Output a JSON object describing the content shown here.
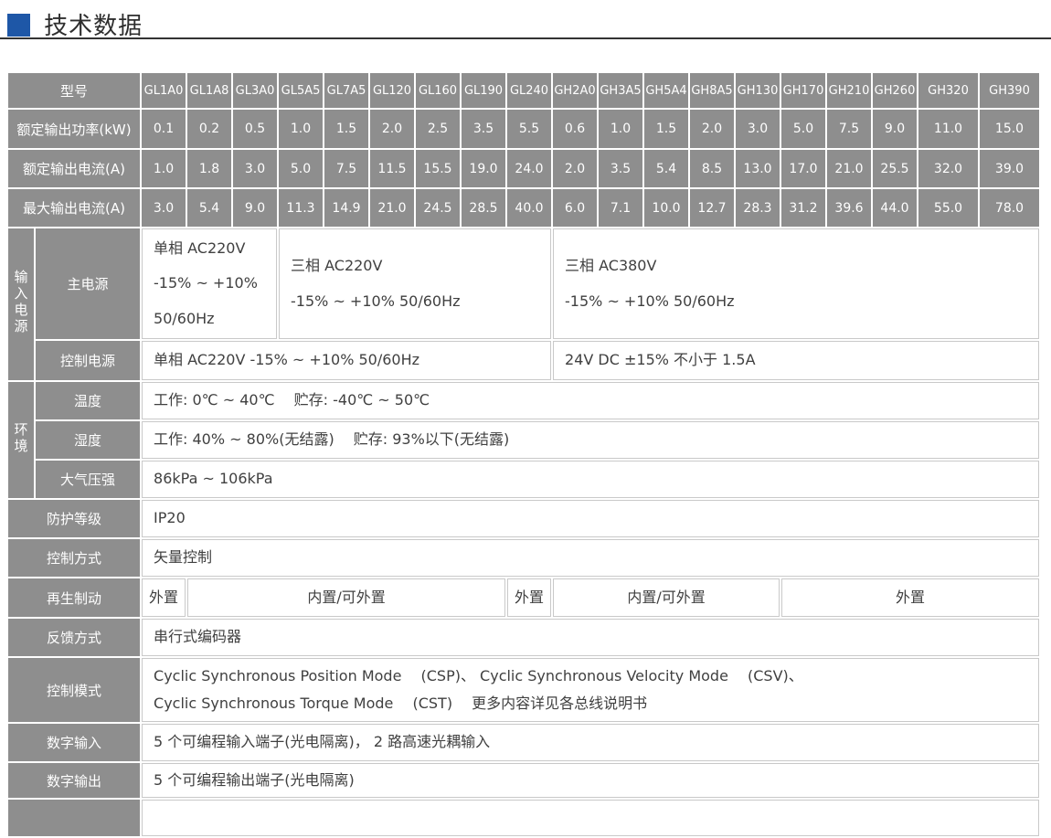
{
  "title": {
    "text": "技术数据"
  },
  "accent_color": "#1e57a7",
  "table": {
    "models": {
      "label": "型号",
      "cols": [
        "GL1A0",
        "GL1A8",
        "GL3A0",
        "GL5A5",
        "GL7A5",
        "GL120",
        "GL160",
        "GL190",
        "GL240",
        "GH2A0",
        "GH3A5",
        "GH5A4",
        "GH8A5",
        "GH130",
        "GH170",
        "GH210",
        "GH260",
        "GH320",
        "GH390"
      ]
    },
    "rated_power": {
      "label": "额定输出功率(kW)",
      "values": [
        "0.1",
        "0.2",
        "0.5",
        "1.0",
        "1.5",
        "2.0",
        "2.5",
        "3.5",
        "5.5",
        "0.6",
        "1.0",
        "1.5",
        "2.0",
        "3.0",
        "5.0",
        "7.5",
        "9.0",
        "11.0",
        "15.0"
      ]
    },
    "rated_current": {
      "label": "额定输出电流(A)",
      "values": [
        "1.0",
        "1.8",
        "3.0",
        "5.0",
        "7.5",
        "11.5",
        "15.5",
        "19.0",
        "24.0",
        "2.0",
        "3.5",
        "5.4",
        "8.5",
        "13.0",
        "17.0",
        "21.0",
        "25.5",
        "32.0",
        "39.0"
      ]
    },
    "max_current": {
      "label": "最大输出电流(A)",
      "values": [
        "3.0",
        "5.4",
        "9.0",
        "11.3",
        "14.9",
        "21.0",
        "24.5",
        "28.5",
        "40.0",
        "6.0",
        "7.1",
        "10.0",
        "12.7",
        "28.3",
        "31.2",
        "39.6",
        "44.0",
        "55.0",
        "78.0"
      ]
    },
    "input_power": {
      "group_label": "输入电源",
      "main": {
        "label": "主电源",
        "single_phase": "单相 AC220V\n-15% ~ +10%\n50/60Hz",
        "three_phase_220": "三相 AC220V\n-15% ~ +10% 50/60Hz",
        "three_phase_380": "三相 AC380V\n-15% ~ +10% 50/60Hz"
      },
      "control": {
        "label": "控制电源",
        "gl_value": "单相 AC220V -15% ~ +10% 50/60Hz",
        "gh_value": "24V DC  ±15%  不小于 1.5A"
      }
    },
    "environment": {
      "group_label": "环境",
      "temperature": {
        "label": "温度",
        "value": "工作:  0℃ ~ 40℃ 　贮存:  -40℃ ~ 50℃"
      },
      "humidity": {
        "label": "湿度",
        "value": "工作:  40% ~ 80%(无结露) 　贮存:  93%以下(无结露)"
      },
      "pressure": {
        "label": "大气压强",
        "value": "86kPa ~ 106kPa"
      }
    },
    "protection": {
      "label": "防护等级",
      "value": "IP20"
    },
    "control_method": {
      "label": "控制方式",
      "value": "矢量控制"
    },
    "braking": {
      "label": "再生制动",
      "cells": [
        "外置",
        "内置/可外置",
        "外置",
        "内置/可外置",
        "外置"
      ]
    },
    "feedback": {
      "label": "反馈方式",
      "value": "串行式编码器"
    },
    "control_mode": {
      "label": "控制模式",
      "value": "Cyclic Synchronous Position Mode 　(CSP)、 Cyclic Synchronous Velocity Mode 　(CSV)、\nCyclic Synchronous Torque Mode 　(CST)　 更多内容详见各总线说明书"
    },
    "digital_input": {
      "label": "数字输入",
      "value": "5 个可编程输入端子(光电隔离)， 2 路高速光耦输入"
    },
    "digital_output": {
      "label": "数字输出",
      "value": "5 个可编程输出端子(光电隔离)"
    },
    "partial_row": {
      "label": "",
      "value": ""
    }
  }
}
